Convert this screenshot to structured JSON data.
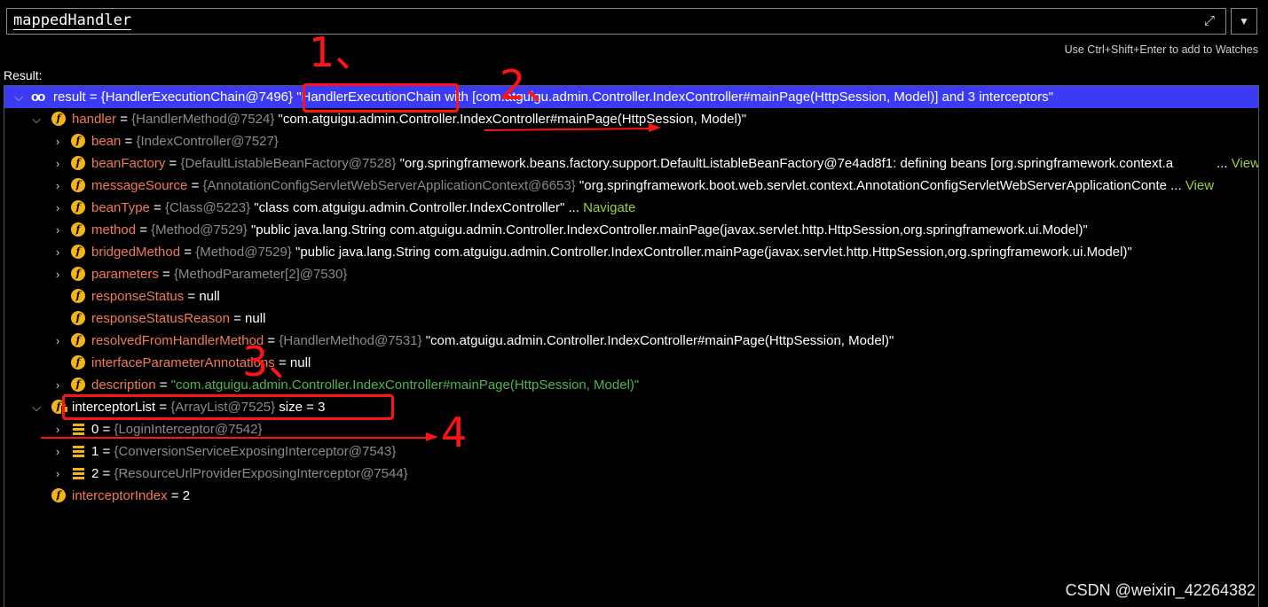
{
  "expression": {
    "value": "mappedHandler",
    "expand_icon": "expand-arrows-icon",
    "history_icon": "chevron-down-icon"
  },
  "hint": "Use Ctrl+Shift+Enter to add to Watches",
  "result_label": "Result:",
  "rows": [
    {
      "name": "result",
      "ref": "{HandlerExecutionChain@7496}",
      "value": "\"HandlerExecutionChain with [com.atguigu.admin.Controller.IndexController#mainPage(HttpSession, Model)] and 3 interceptors\""
    },
    {
      "name": "handler",
      "ref": "{HandlerMethod@7524}",
      "value": "\"com.atguigu.admin.Controller.IndexController#mainPage(HttpSession, Model)\""
    },
    {
      "name": "bean",
      "ref": "{IndexController@7527}",
      "value": ""
    },
    {
      "name": "beanFactory",
      "ref": "{DefaultListableBeanFactory@7528}",
      "value": "\"org.springframework.beans.factory.support.DefaultListableBeanFactory@7e4ad8f1: defining beans [org.springframework.context.a",
      "link": "View"
    },
    {
      "name": "messageSource",
      "ref": "{AnnotationConfigServletWebServerApplicationContext@6653}",
      "value": "\"org.springframework.boot.web.servlet.context.AnnotationConfigServletWebServerApplicationConte ...",
      "link": "View"
    },
    {
      "name": "beanType",
      "ref": "{Class@5223}",
      "value": "\"class com.atguigu.admin.Controller.IndexController\" ...",
      "link": "Navigate"
    },
    {
      "name": "method",
      "ref": "{Method@7529}",
      "value": "\"public java.lang.String com.atguigu.admin.Controller.IndexController.mainPage(javax.servlet.http.HttpSession,org.springframework.ui.Model)\""
    },
    {
      "name": "bridgedMethod",
      "ref": "{Method@7529}",
      "value": "\"public java.lang.String com.atguigu.admin.Controller.IndexController.mainPage(javax.servlet.http.HttpSession,org.springframework.ui.Model)\""
    },
    {
      "name": "parameters",
      "ref": "{MethodParameter[2]@7530}",
      "value": ""
    },
    {
      "name": "responseStatus",
      "ref": "",
      "value": "null"
    },
    {
      "name": "responseStatusReason",
      "ref": "",
      "value": "null"
    },
    {
      "name": "resolvedFromHandlerMethod",
      "ref": "{HandlerMethod@7531}",
      "value": "\"com.atguigu.admin.Controller.IndexController#mainPage(HttpSession, Model)\""
    },
    {
      "name": "interfaceParameterAnnotations",
      "ref": "",
      "value": "null"
    },
    {
      "name": "description",
      "ref": "",
      "value": "\"com.atguigu.admin.Controller.IndexController#mainPage(HttpSession, Model)\""
    },
    {
      "name": "interceptorList",
      "ref": "{ArrayList@7525}",
      "value": "size = 3"
    },
    {
      "name": "0",
      "ref": "{LoginInterceptor@7542}",
      "value": ""
    },
    {
      "name": "1",
      "ref": "{ConversionServiceExposingInterceptor@7543}",
      "value": ""
    },
    {
      "name": "2",
      "ref": "{ResourceUrlProviderExposingInterceptor@7544}",
      "value": ""
    },
    {
      "name": "interceptorIndex",
      "ref": "",
      "value": "2"
    }
  ],
  "annotations": [
    "1、",
    "2、",
    "3、",
    "4"
  ],
  "watermark": "CSDN @weixin_42264382",
  "colors": {
    "selection": "#3b3bf5",
    "field_name": "#f07a55",
    "type_ref": "#8b8b8b",
    "string_green": "#4fb34f",
    "link": "#9bd13a",
    "annotation_red": "#ff1414",
    "field_icon": "#f2b416"
  }
}
